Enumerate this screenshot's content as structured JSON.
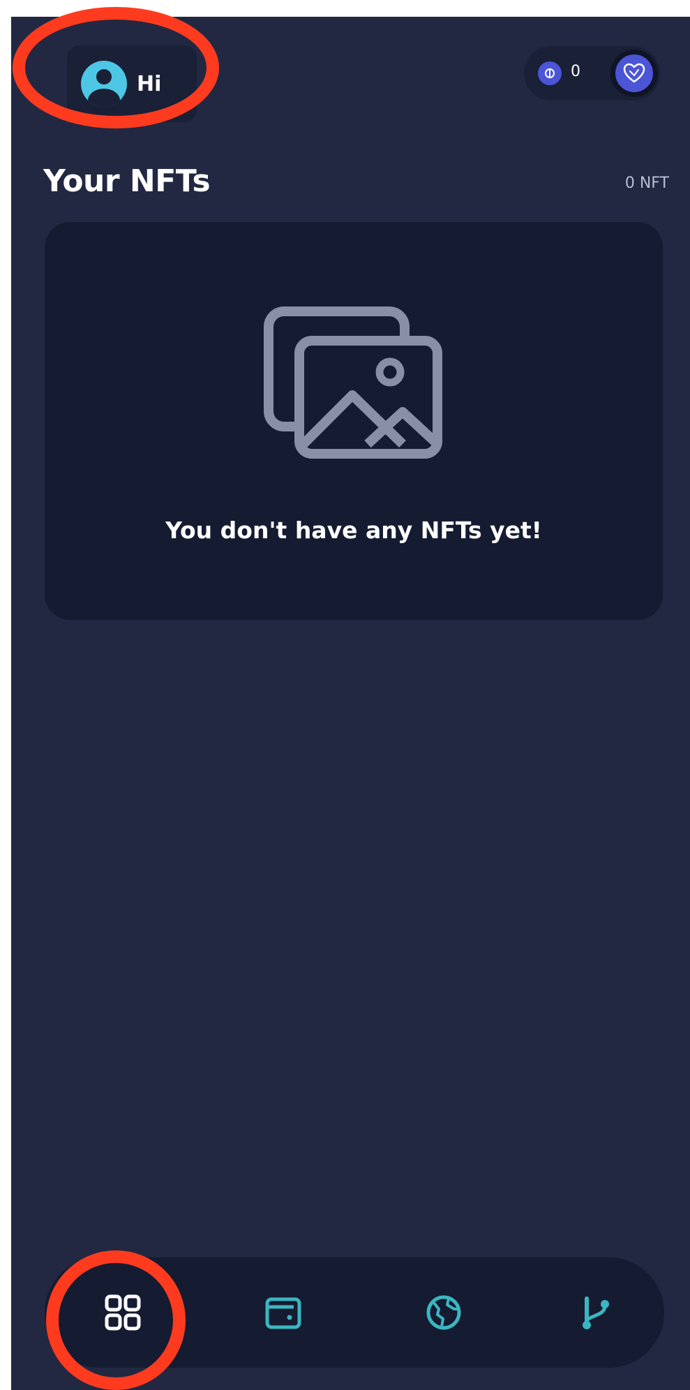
{
  "header": {
    "greeting": "Hi",
    "balance": "0"
  },
  "section": {
    "title": "Your NFTs",
    "count": "0 NFT"
  },
  "empty_state": {
    "message": "You don't have any NFTs yet!"
  },
  "nav": {
    "items": [
      {
        "icon": "grid-icon",
        "active": true
      },
      {
        "icon": "wallet-icon",
        "active": false
      },
      {
        "icon": "globe-icon",
        "active": false
      },
      {
        "icon": "branch-icon",
        "active": false
      }
    ]
  },
  "colors": {
    "background": "#222842",
    "card": "#151b30",
    "accent": "#4ec6e5",
    "brand": "#4b55d6",
    "annotation": "#ff3b1f"
  }
}
